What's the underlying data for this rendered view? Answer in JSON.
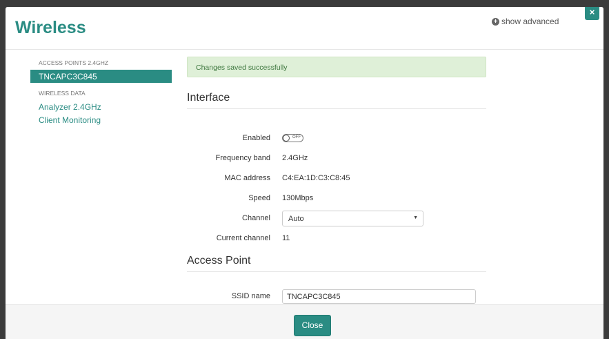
{
  "header": {
    "title": "Wireless",
    "show_advanced": "show advanced",
    "close_icon_glyph": "×"
  },
  "sidebar": {
    "groups": [
      {
        "heading": "ACCESS POINTS 2.4GHZ",
        "items": [
          {
            "label": "TNCAPC3C845",
            "active": true
          }
        ]
      },
      {
        "heading": "WIRELESS DATA",
        "items": [
          {
            "label": "Analyzer 2.4GHz"
          },
          {
            "label": "Client Monitoring"
          }
        ]
      }
    ]
  },
  "alert": {
    "message": "Changes saved successfully"
  },
  "interface": {
    "title": "Interface",
    "enabled": {
      "label": "Enabled",
      "state": "OFF"
    },
    "frequency_band": {
      "label": "Frequency band",
      "value": "2.4GHz"
    },
    "mac_address": {
      "label": "MAC address",
      "value": "C4:EA:1D:C3:C8:45"
    },
    "speed": {
      "label": "Speed",
      "value": "130Mbps"
    },
    "channel": {
      "label": "Channel",
      "selected": "Auto"
    },
    "current_channel": {
      "label": "Current channel",
      "value": "11"
    }
  },
  "access_point": {
    "title": "Access Point",
    "ssid": {
      "label": "SSID name",
      "value": "TNCAPC3C845"
    }
  },
  "footer": {
    "close_label": "Close"
  },
  "colors": {
    "accent": "#2a8c83",
    "alert_bg": "#dff0d8",
    "alert_text": "#3c763d"
  }
}
